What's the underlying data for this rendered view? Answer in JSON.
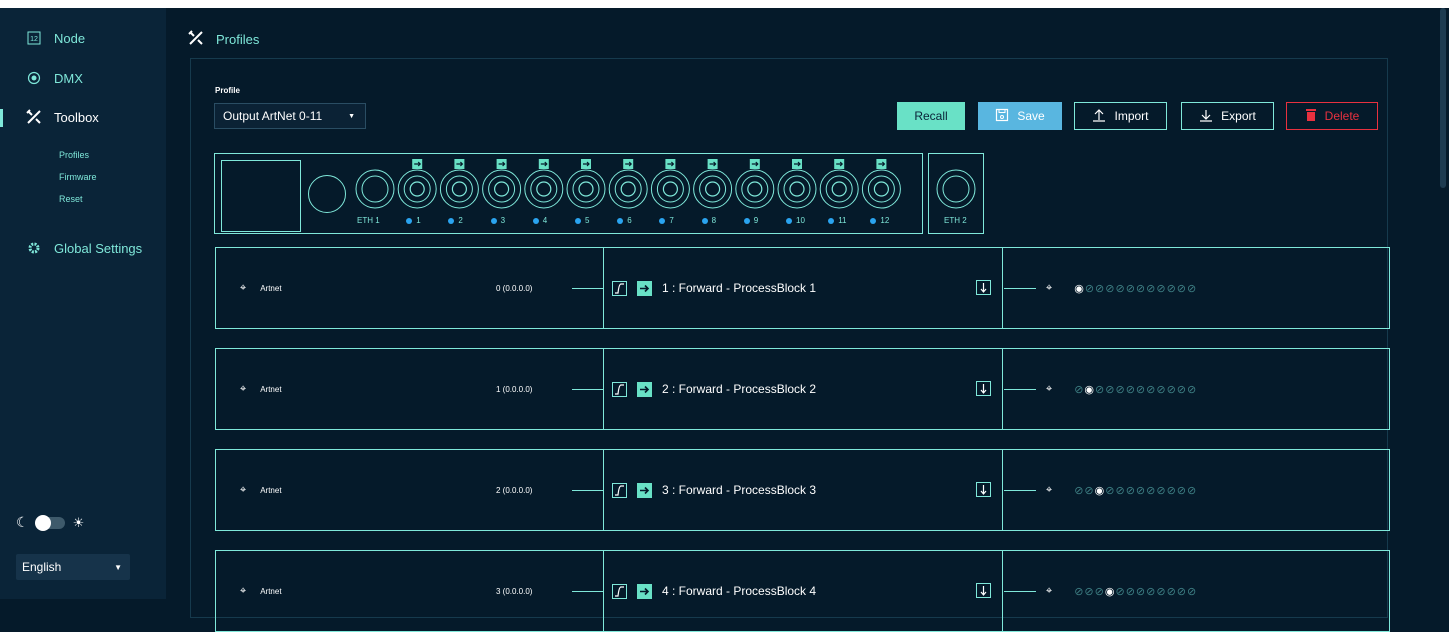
{
  "sidebar": {
    "items": [
      {
        "label": "Node",
        "icon": "node-icon"
      },
      {
        "label": "DMX",
        "icon": "dmx-icon"
      },
      {
        "label": "Toolbox",
        "icon": "toolbox-icon"
      },
      {
        "label": "Global Settings",
        "icon": "gear-icon"
      }
    ],
    "toolbox_sub": [
      "Profiles",
      "Firmware",
      "Reset"
    ],
    "language": "English"
  },
  "header": {
    "title": "Profiles"
  },
  "profile": {
    "label": "Profile",
    "selected": "Output ArtNet 0-11"
  },
  "toolbar": {
    "recall": "Recall",
    "save": "Save",
    "import": "Import",
    "export": "Export",
    "delete": "Delete"
  },
  "device": {
    "eth1": "ETH 1",
    "eth2": "ETH 2",
    "ports": [
      "1",
      "2",
      "3",
      "4",
      "5",
      "6",
      "7",
      "8",
      "9",
      "10",
      "11",
      "12"
    ]
  },
  "rows": [
    {
      "protocol": "Artnet",
      "universe": "0 (0.0.0.0)",
      "block": "1 : Forward - ProcessBlock 1",
      "active_port": 1
    },
    {
      "protocol": "Artnet",
      "universe": "1 (0.0.0.0)",
      "block": "2 : Forward - ProcessBlock 2",
      "active_port": 2
    },
    {
      "protocol": "Artnet",
      "universe": "2 (0.0.0.0)",
      "block": "3 : Forward - ProcessBlock 3",
      "active_port": 3
    },
    {
      "protocol": "Artnet",
      "universe": "3 (0.0.0.0)",
      "block": "4 : Forward - ProcessBlock 4",
      "active_port": 4
    }
  ],
  "colors": {
    "accent": "#7fe8da",
    "recall_bg": "#69e1c6",
    "save_bg": "#59b6e0",
    "delete": "#e8313f",
    "background": "#051a2a",
    "sidebar": "#0a2438"
  }
}
